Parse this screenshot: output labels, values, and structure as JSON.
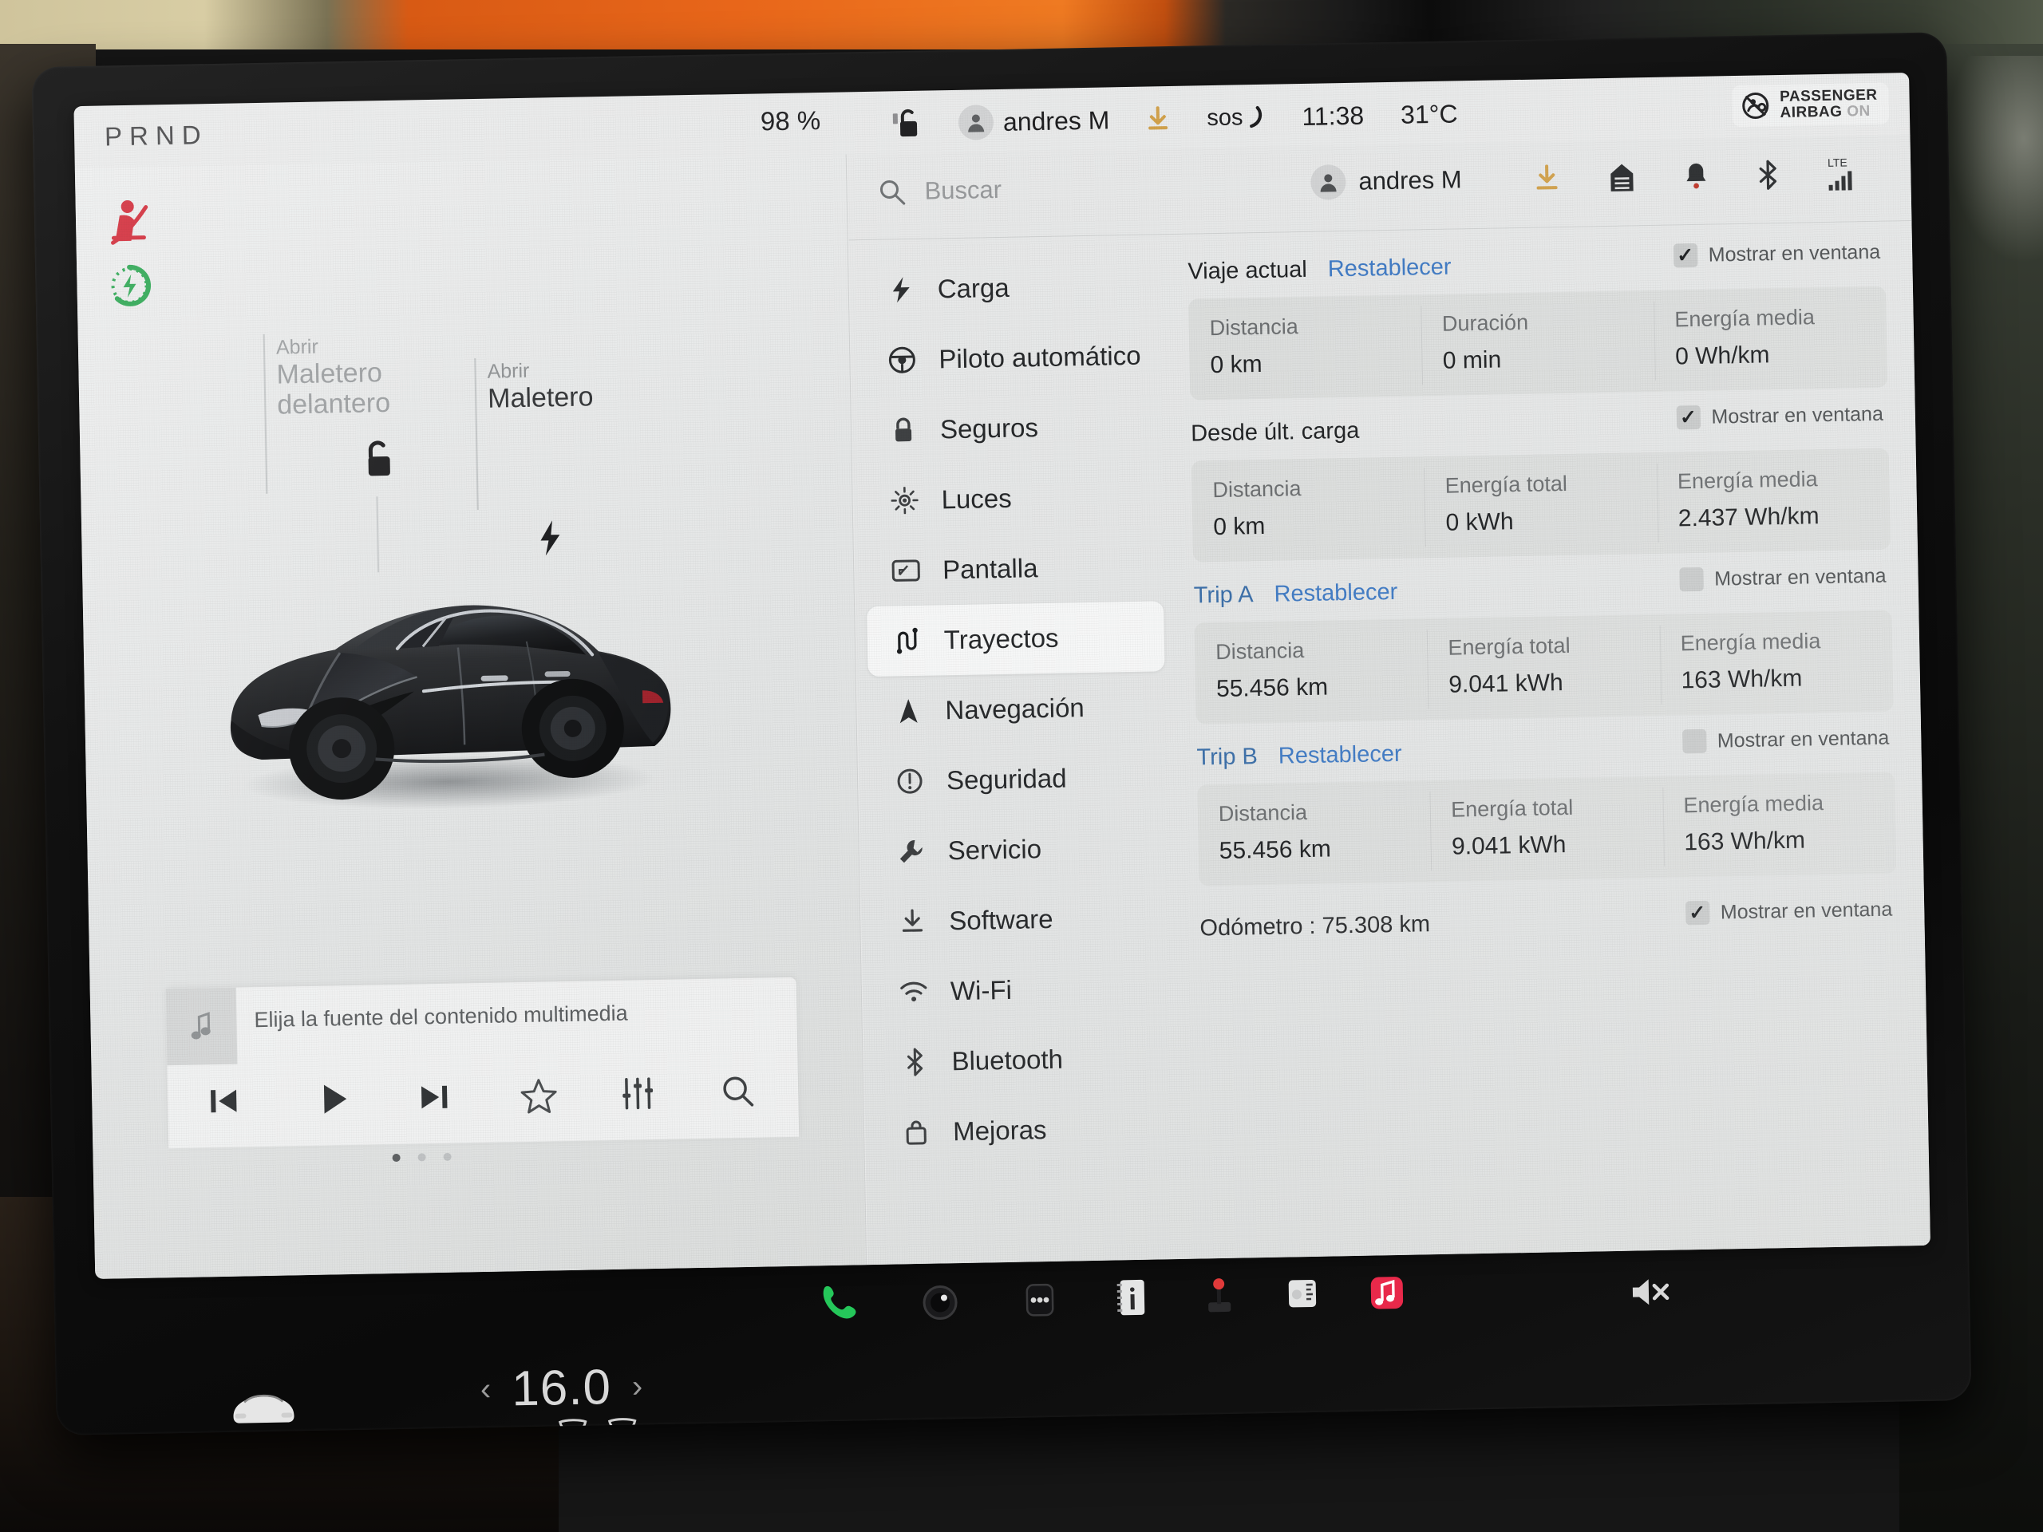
{
  "status_bar": {
    "gear_indicator": "PRND",
    "battery_percent": "98 %",
    "lock_icon": "unlock-icon",
    "driver_profile": "andres M",
    "download_icon": "download-icon",
    "sos_label": "sos",
    "time": "11:38",
    "temperature": "31°C",
    "passenger_airbag_line1": "PASSENGER",
    "passenger_airbag_line2": "AIRBAG",
    "passenger_airbag_state": "ON"
  },
  "left_panel": {
    "warning_seatbelt_icon": "seatbelt-warning-icon",
    "warning_regen_icon": "regenerative-braking-limited-icon",
    "frunk": {
      "action": "Abrir",
      "name_line1": "Maletero",
      "name_line2": "delantero"
    },
    "trunk": {
      "action": "Abrir",
      "name_line1": "Maletero"
    },
    "lock_icon": "unlock-icon",
    "charge_port_icon": "charge-port-icon",
    "vehicle_image": "tesla-model-3-black-frunk-open"
  },
  "media": {
    "title": "Elija la fuente del contenido multimedia",
    "album_art_icon": "music-note-icon",
    "controls": [
      {
        "name": "previous-track-button",
        "icon": "skip-previous-icon"
      },
      {
        "name": "play-button",
        "icon": "play-icon"
      },
      {
        "name": "next-track-button",
        "icon": "skip-next-icon"
      },
      {
        "name": "favorite-button",
        "icon": "star-icon"
      },
      {
        "name": "equalizer-button",
        "icon": "equalizer-icon"
      },
      {
        "name": "media-search-button",
        "icon": "search-icon"
      }
    ],
    "page_dots": 3,
    "page_dot_active": 1
  },
  "search": {
    "placeholder": "Buscar",
    "icon": "search-icon"
  },
  "top_right_icons": [
    {
      "name": "profile-chip",
      "label": "andres M"
    },
    {
      "name": "software-download-icon"
    },
    {
      "name": "garage-door-icon"
    },
    {
      "name": "notification-bell-icon"
    },
    {
      "name": "bluetooth-icon"
    },
    {
      "name": "lte-signal-icon",
      "label": "LTE"
    }
  ],
  "menu": {
    "items": [
      {
        "label": "Carga",
        "icon": "bolt-icon",
        "selected": false
      },
      {
        "label": "Piloto automático",
        "icon": "steering-wheel-icon",
        "selected": false
      },
      {
        "label": "Seguros",
        "icon": "lock-icon",
        "selected": false
      },
      {
        "label": "Luces",
        "icon": "light-icon",
        "selected": false
      },
      {
        "label": "Pantalla",
        "icon": "display-icon",
        "selected": false
      },
      {
        "label": "Trayectos",
        "icon": "trips-icon",
        "selected": true
      },
      {
        "label": "Navegación",
        "icon": "navigation-arrow-icon",
        "selected": false
      },
      {
        "label": "Seguridad",
        "icon": "safety-alert-icon",
        "selected": false
      },
      {
        "label": "Servicio",
        "icon": "wrench-icon",
        "selected": false
      },
      {
        "label": "Software",
        "icon": "download-icon",
        "selected": false
      },
      {
        "label": "Wi-Fi",
        "icon": "wifi-icon",
        "selected": false
      },
      {
        "label": "Bluetooth",
        "icon": "bluetooth-icon",
        "selected": false
      },
      {
        "label": "Mejoras",
        "icon": "upgrades-bag-icon",
        "selected": false
      }
    ]
  },
  "trips": {
    "show_in_window_label": "Mostrar en ventana",
    "reset_label": "Restablecer",
    "blocks": [
      {
        "name": "Viaje actual",
        "has_reset": true,
        "show_in_window": true,
        "stats": [
          {
            "label": "Distancia",
            "value": "0 km"
          },
          {
            "label": "Duración",
            "value": "0 min"
          },
          {
            "label": "Energía media",
            "value": "0 Wh/km"
          }
        ]
      },
      {
        "name": "Desde últ. carga",
        "has_reset": false,
        "show_in_window": true,
        "stats": [
          {
            "label": "Distancia",
            "value": "0 km"
          },
          {
            "label": "Energía total",
            "value": "0 kWh"
          },
          {
            "label": "Energía media",
            "value": "2.437 Wh/km"
          }
        ]
      },
      {
        "name": "Trip A",
        "has_reset": true,
        "show_in_window": false,
        "stats": [
          {
            "label": "Distancia",
            "value": "55.456 km"
          },
          {
            "label": "Energía total",
            "value": "9.041 kWh"
          },
          {
            "label": "Energía media",
            "value": "163 Wh/km"
          }
        ]
      },
      {
        "name": "Trip B",
        "has_reset": true,
        "show_in_window": false,
        "stats": [
          {
            "label": "Distancia",
            "value": "55.456 km"
          },
          {
            "label": "Energía total",
            "value": "9.041 kWh"
          },
          {
            "label": "Energía media",
            "value": "163 Wh/km"
          }
        ]
      }
    ],
    "odometer": {
      "text": "Odómetro :  75.308 km",
      "show_in_window": true
    }
  },
  "dock": [
    {
      "name": "dock-phone",
      "icon": "phone-icon",
      "color": "#25c75a"
    },
    {
      "name": "dock-camera",
      "icon": "dashcam-icon"
    },
    {
      "name": "dock-more",
      "icon": "three-dots-icon"
    },
    {
      "name": "dock-manual",
      "icon": "owners-manual-icon"
    },
    {
      "name": "dock-arcade",
      "icon": "joystick-icon"
    },
    {
      "name": "dock-toybox",
      "icon": "toybox-icon"
    },
    {
      "name": "dock-music",
      "icon": "music-app-icon",
      "color": "#e8294a"
    },
    {
      "name": "dock-mute",
      "icon": "volume-mute-icon"
    }
  ],
  "climate": {
    "car_icon": "car-front-icon",
    "prev_arrow": "‹",
    "next_arrow": "›",
    "temperature": "16.0",
    "defroster_front_icon": "defrost-front-icon",
    "defroster_rear_icon": "defrost-rear-icon"
  },
  "colors": {
    "accent_blue": "#3f7ac4",
    "warning_red": "#d01f2e",
    "regen_green": "#22a34a",
    "screen_bg": "#e9eaea",
    "panel_bg": "#dcdedd"
  }
}
